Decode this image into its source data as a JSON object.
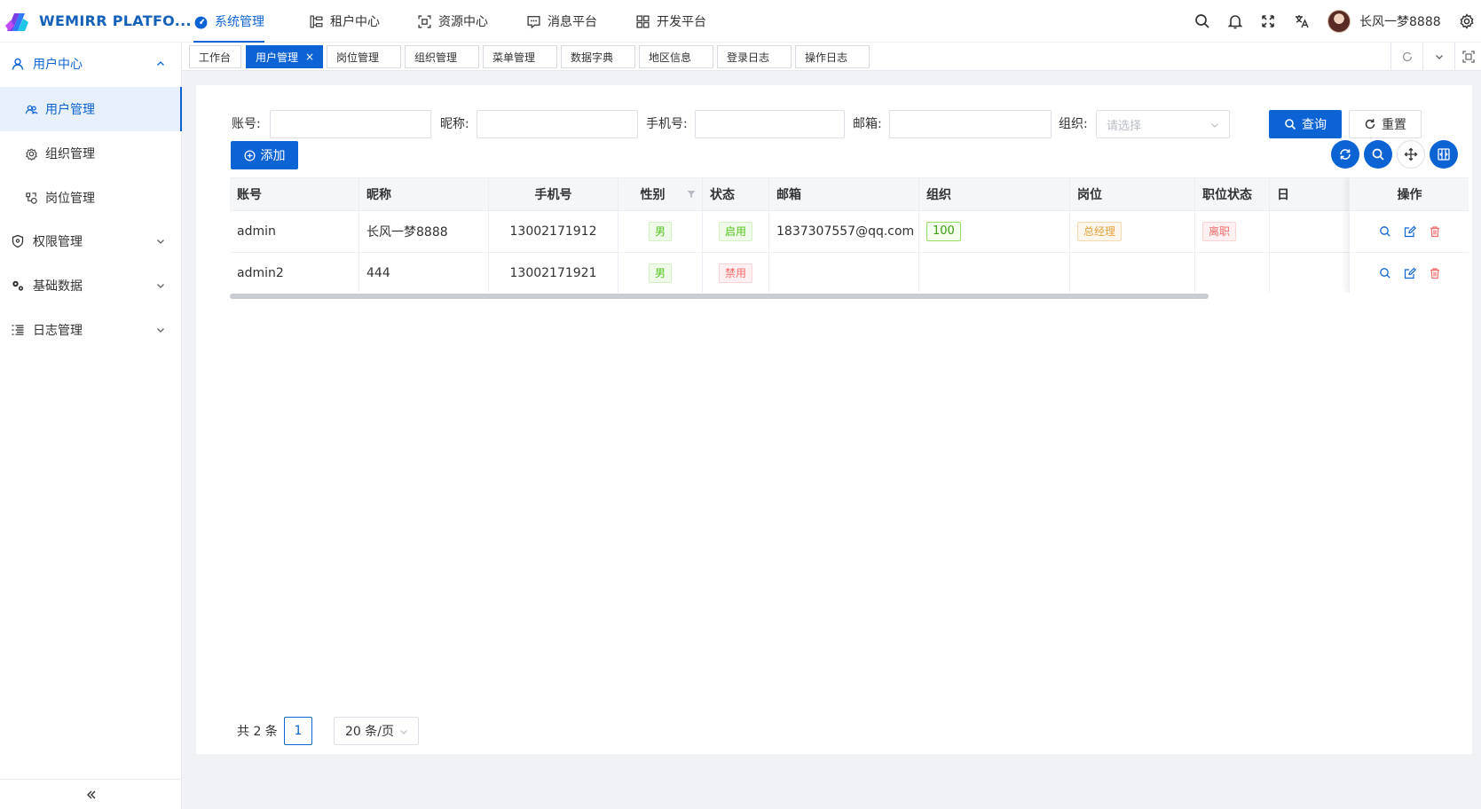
{
  "app": {
    "brand": "WEMIRR PLATFO..."
  },
  "topnav": [
    {
      "label": "系统管理",
      "icon": "dashboard-icon",
      "active": true
    },
    {
      "label": "租户中心",
      "icon": "tenant-icon"
    },
    {
      "label": "资源中心",
      "icon": "resource-icon"
    },
    {
      "label": "消息平台",
      "icon": "message-icon"
    },
    {
      "label": "开发平台",
      "icon": "apps-icon"
    }
  ],
  "user": {
    "name": "长风一梦8888"
  },
  "sidebar": {
    "groups": [
      {
        "label": "用户中心",
        "icon": "user-icon",
        "open": true
      },
      {
        "label": "权限管理",
        "icon": "shield-icon"
      },
      {
        "label": "基础数据",
        "icon": "gears-icon"
      },
      {
        "label": "日志管理",
        "icon": "list-icon"
      }
    ],
    "sub_items": [
      {
        "label": "用户管理",
        "icon": "users-icon",
        "active": true
      },
      {
        "label": "组织管理",
        "icon": "org-icon"
      },
      {
        "label": "岗位管理",
        "icon": "post-icon"
      }
    ]
  },
  "tabs": [
    {
      "label": "工作台"
    },
    {
      "label": "用户管理",
      "active": true,
      "close": "×"
    },
    {
      "label": "岗位管理"
    },
    {
      "label": "组织管理"
    },
    {
      "label": "菜单管理"
    },
    {
      "label": "数据字典"
    },
    {
      "label": "地区信息"
    },
    {
      "label": "登录日志"
    },
    {
      "label": "操作日志"
    }
  ],
  "filters": {
    "account_label": "账号:",
    "account_value": "",
    "nickname_label": "昵称:",
    "nickname_value": "",
    "mobile_label": "手机号:",
    "mobile_value": "",
    "email_label": "邮箱:",
    "email_value": "",
    "org_label": "组织:",
    "org_placeholder": "请选择",
    "search_label": "查询",
    "reset_label": "重置"
  },
  "toolbar": {
    "add_label": "添加"
  },
  "table": {
    "columns": [
      "账号",
      "昵称",
      "手机号",
      "性别",
      "状态",
      "邮箱",
      "组织",
      "岗位",
      "职位状态",
      "日",
      "操作"
    ],
    "rows": [
      {
        "account": "admin",
        "nickname": "长风一梦8888",
        "mobile": "13002171912",
        "sex": "男",
        "status": "启用",
        "email": "1837307557@qq.com",
        "org": "100",
        "post": "总经理",
        "post_status": "离职"
      },
      {
        "account": "admin2",
        "nickname": "444",
        "mobile": "13002171921",
        "sex": "男",
        "status": "禁用",
        "email": "",
        "org": "",
        "post": "",
        "post_status": ""
      }
    ]
  },
  "pagination": {
    "total": "共 2 条",
    "current": "1",
    "page_size": "20 条/页"
  },
  "colors": {
    "primary": "#0c63d4",
    "success": "#52c41a",
    "danger": "#f56c6c",
    "warning": "#e6a23c"
  }
}
